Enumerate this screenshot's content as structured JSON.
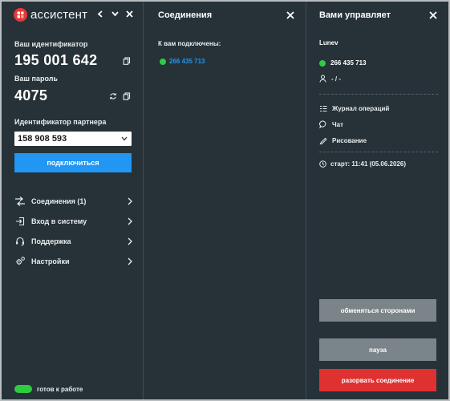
{
  "app": {
    "name": "ассистент"
  },
  "left": {
    "your_id_label": "Ваш идентификатор",
    "your_id": "195 001 642",
    "password_label": "Ваш пароль",
    "password": "4075",
    "partner_label": "Идентификатор партнера",
    "partner_id": "158 908 593",
    "connect_label": "подключиться",
    "menu": [
      {
        "label": "Соединения (1)",
        "icon": "connections-icon"
      },
      {
        "label": "Вход в систему",
        "icon": "login-icon"
      },
      {
        "label": "Поддержка",
        "icon": "headset-icon"
      },
      {
        "label": "Настройки",
        "icon": "gear-icon"
      }
    ],
    "status_label": "готов к работе"
  },
  "middle": {
    "title": "Соединения",
    "connected_label": "К вам подключены:",
    "connections": [
      {
        "id": "266 435 713",
        "status": "online"
      }
    ]
  },
  "right": {
    "title": "Вами управляет",
    "user": "Lunev",
    "remote_id": "266 435 713",
    "person_value": "- / -",
    "actions": [
      {
        "label": "Журнал операций",
        "icon": "log-icon"
      },
      {
        "label": "Чат",
        "icon": "chat-icon"
      },
      {
        "label": "Рисование",
        "icon": "pen-icon"
      }
    ],
    "start_label": "старт: 11:41 (05.06.2026)",
    "swap_label": "обменяться сторонами",
    "pause_label": "пауза",
    "disconnect_label": "разорвать соединение"
  },
  "colors": {
    "background": "#263238",
    "accent_blue": "#2196f3",
    "online_green": "#2ecc40",
    "danger_red": "#e03131",
    "neutral_button": "#7b8489",
    "brand_red": "#e53935"
  }
}
